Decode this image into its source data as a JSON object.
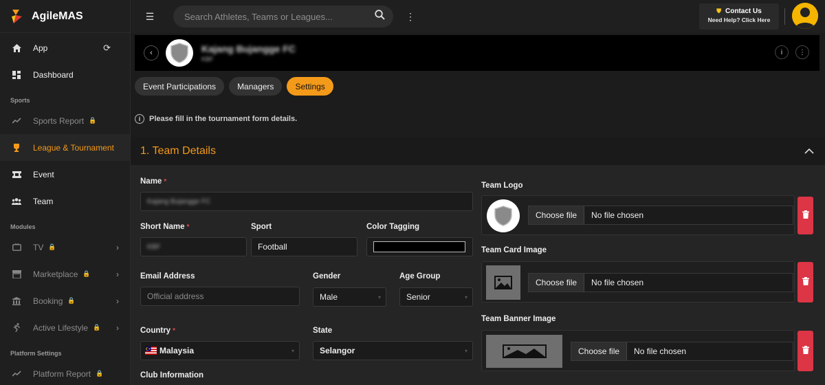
{
  "app": {
    "name": "AgileMAS"
  },
  "sidebar": {
    "items": [
      {
        "label": "App"
      },
      {
        "label": "Dashboard"
      }
    ],
    "sections": [
      "Sports",
      "Modules",
      "Platform Settings"
    ],
    "sports_items": [
      {
        "label": "Sports Report"
      },
      {
        "label": "League & Tournament"
      },
      {
        "label": "Event"
      },
      {
        "label": "Team"
      }
    ],
    "module_items": [
      {
        "label": "TV"
      },
      {
        "label": "Marketplace"
      },
      {
        "label": "Booking"
      },
      {
        "label": "Active Lifestyle"
      }
    ],
    "platform_items": [
      {
        "label": "Platform Report"
      }
    ]
  },
  "topbar": {
    "search_placeholder": "Search Athletes, Teams or Leagues...",
    "contact_title": "Contact Us",
    "contact_sub": "Need Help? Click Here"
  },
  "header": {
    "team_name": "Kajang Bujangge FC",
    "team_short": "KBF"
  },
  "tabs": [
    {
      "label": "Event Participations"
    },
    {
      "label": "Managers"
    },
    {
      "label": "Settings"
    }
  ],
  "info_text": "Please fill in the tournament form details.",
  "section_title": "1. Team Details",
  "form": {
    "name_label": "Name",
    "name_value": "Kajang Bujangge FC",
    "short_name_label": "Short Name",
    "short_name_value": "KBF",
    "sport_label": "Sport",
    "sport_value": "Football",
    "color_label": "Color Tagging",
    "color_value": "#000000",
    "email_label": "Email Address",
    "email_placeholder": "Official address",
    "gender_label": "Gender",
    "gender_value": "Male",
    "age_label": "Age Group",
    "age_value": "Senior",
    "country_label": "Country",
    "country_value": "Malaysia",
    "state_label": "State",
    "state_value": "Selangor",
    "club_label": "Club Information"
  },
  "uploads": {
    "logo_label": "Team Logo",
    "card_label": "Team Card Image",
    "banner_label": "Team Banner Image",
    "choose_label": "Choose file",
    "no_file_label": "No file chosen"
  },
  "colors": {
    "accent": "#f49a1a",
    "danger": "#dc3545"
  }
}
